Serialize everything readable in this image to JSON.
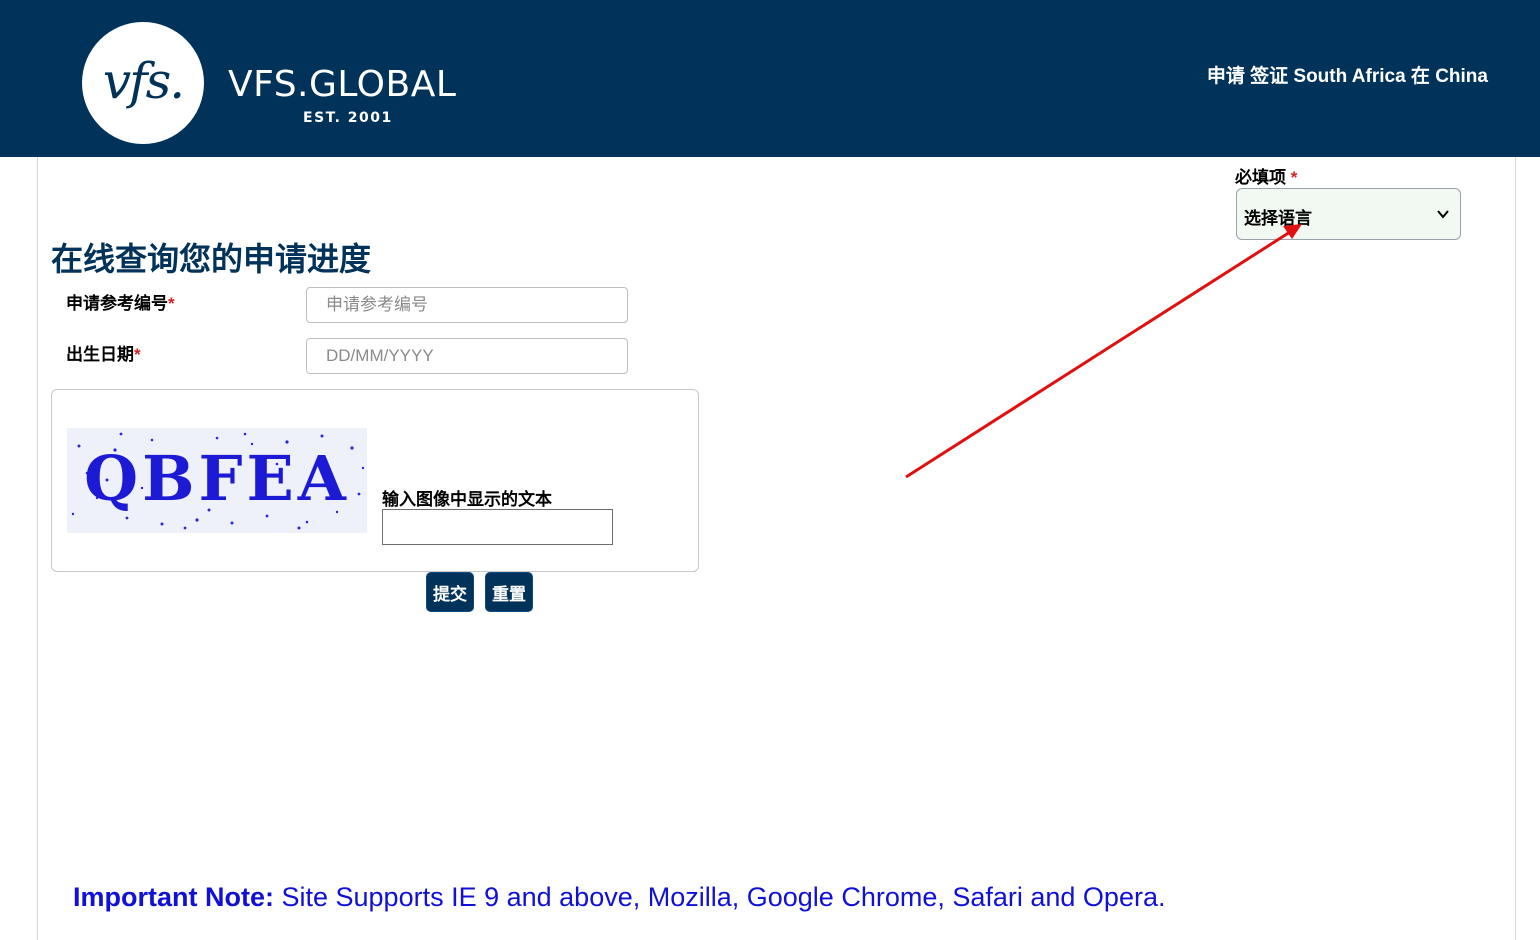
{
  "header": {
    "logo_mark": "vfs.",
    "brand_name": "VFS.GLOBAL",
    "brand_est": "EST. 2001",
    "title": "申请 签证 South Africa  在 China"
  },
  "language": {
    "required_label": "必填项",
    "required_star": "*",
    "select_value": "选择语言"
  },
  "page": {
    "title": "在线查询您的申请进度"
  },
  "form": {
    "reference_label": "申请参考编号",
    "reference_placeholder": "申请参考编号",
    "dob_label": "出生日期",
    "dob_placeholder": "DD/MM/YYYY",
    "required_star": "*"
  },
  "captcha": {
    "image_text": "QBFEA",
    "label": "输入图像中显示的文本",
    "value": ""
  },
  "buttons": {
    "submit": "提交",
    "reset": "重置"
  },
  "note": {
    "prefix": "Important Note:",
    "text": " Site Supports IE 9 and above, Mozilla, Google Chrome, Safari and Opera."
  },
  "colors": {
    "header_bg": "#01325a",
    "accent_red": "#d62020",
    "note_blue": "#1010d8",
    "arrow_red": "#e01010"
  }
}
